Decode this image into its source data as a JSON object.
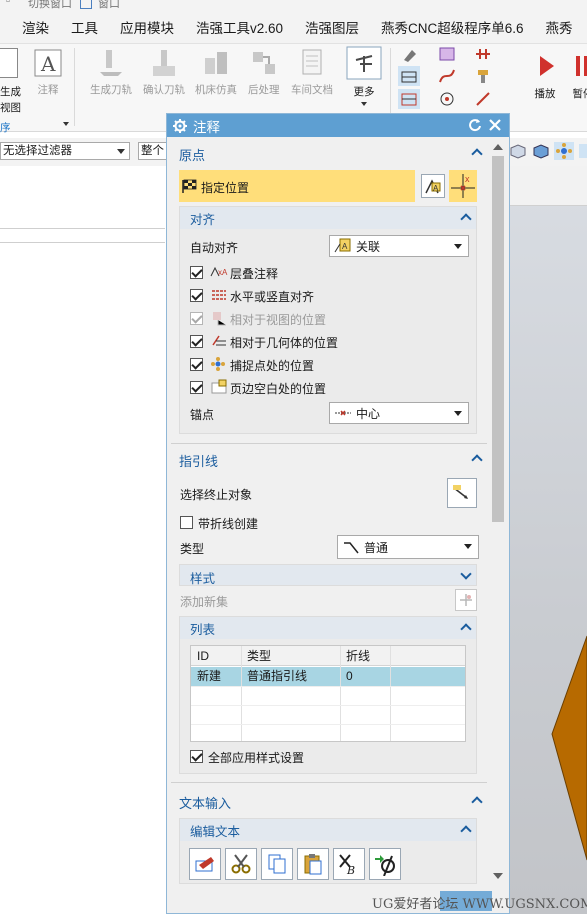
{
  "title_strip": {
    "item1": "切换窗口",
    "item2": "窗口"
  },
  "menu": [
    "渲染",
    "工具",
    "应用模块",
    "浩强工具v2.60",
    "浩强图层",
    "燕秀CNC超级程序单6.6",
    "燕秀"
  ],
  "ribbon": {
    "left_labels": [
      "生成",
      "视图"
    ],
    "group_label": "序",
    "annotation_label": "注释",
    "buttons": [
      "生成刀轨",
      "确认刀轨",
      "机床仿真",
      "后处理",
      "车间文档"
    ],
    "more_label": "更多",
    "play_label": "播放",
    "pause_label": "暂停"
  },
  "filterbar": {
    "filter_value": "无选择过滤器",
    "scope_value": "整个"
  },
  "dialog": {
    "title": "注释",
    "origin": {
      "header": "原点",
      "specify_position": "指定位置",
      "align": {
        "header": "对齐",
        "auto_align_label": "自动对齐",
        "auto_align_value": "关联",
        "options": [
          {
            "label": "层叠注释",
            "checked": true,
            "enabled": true
          },
          {
            "label": "水平或竖直对齐",
            "checked": true,
            "enabled": true
          },
          {
            "label": "相对于视图的位置",
            "checked": true,
            "enabled": false
          },
          {
            "label": "相对于几何体的位置",
            "checked": true,
            "enabled": true
          },
          {
            "label": "捕捉点处的位置",
            "checked": true,
            "enabled": true
          },
          {
            "label": "页边空白处的位置",
            "checked": true,
            "enabled": true
          }
        ],
        "anchor_label": "锚点",
        "anchor_value": "中心"
      }
    },
    "leader": {
      "header": "指引线",
      "select_terminating": "选择终止对象",
      "create_with_jog": "带折线创建",
      "type_label": "类型",
      "type_value": "普通",
      "style_header": "样式",
      "add_new_set": "添加新集",
      "list": {
        "header": "列表",
        "columns": [
          "ID",
          "类型",
          "折线"
        ],
        "rows": [
          {
            "id": "新建",
            "type": "普通指引线",
            "jog": "0"
          }
        ]
      },
      "apply_all_styles": "全部应用样式设置"
    },
    "text_input": {
      "header": "文本输入",
      "edit_text_header": "编辑文本"
    }
  },
  "watermark": "UG爱好者论坛 WWW.UGSNX.COM",
  "colors": {
    "title_bar": "#5e9fd2",
    "highlight": "#ffde7a",
    "selection": "#a8d5e3",
    "accent": "#1a5c9e"
  }
}
